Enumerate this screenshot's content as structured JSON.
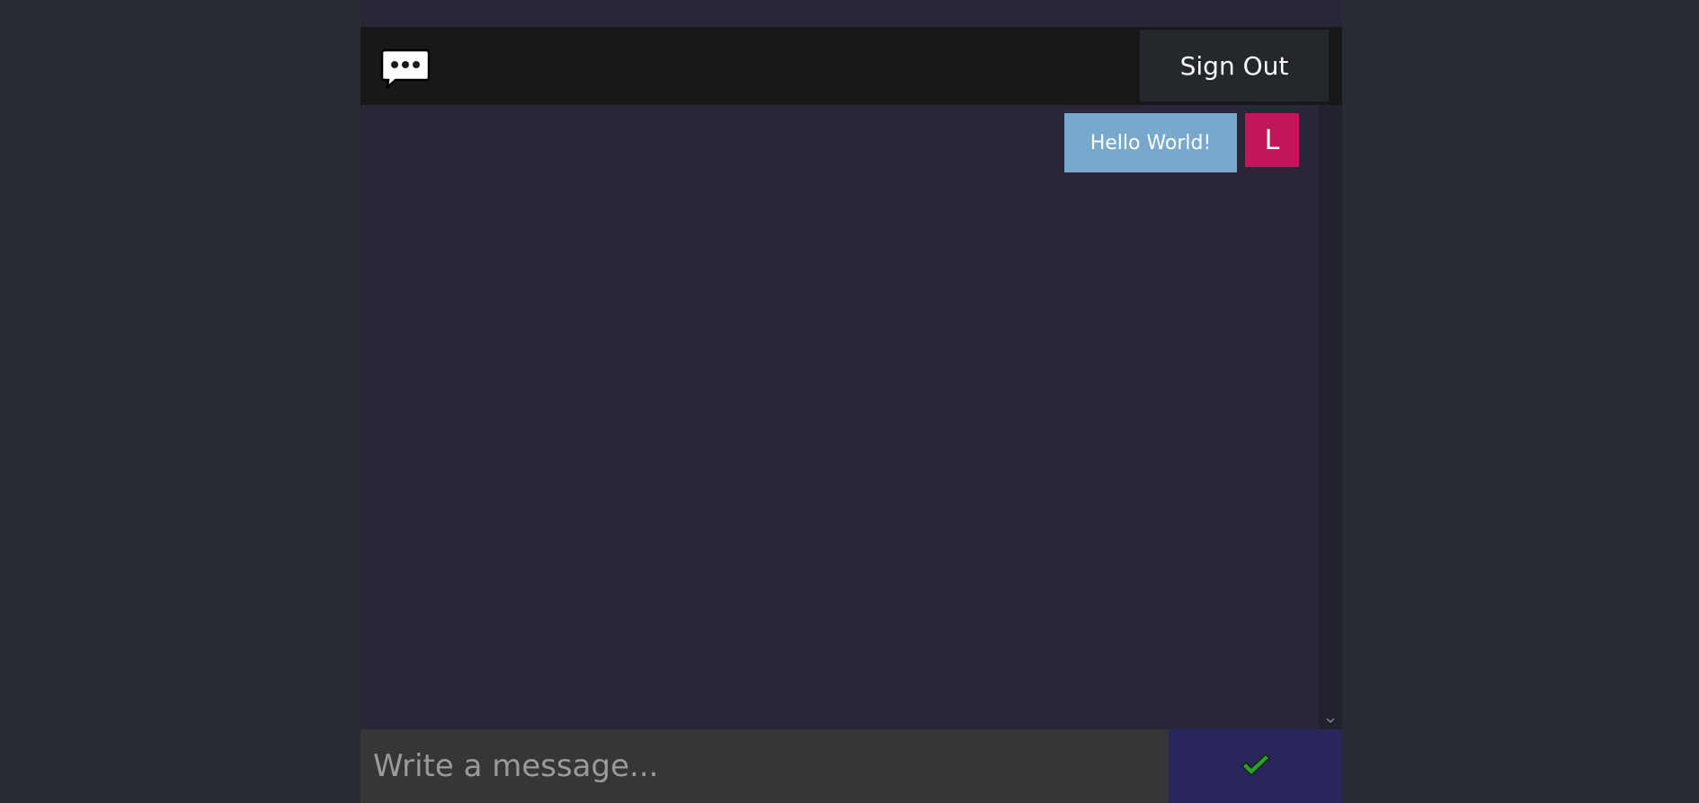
{
  "header": {
    "logo_icon": "chat-bubble-icon",
    "signout_label": "Sign Out"
  },
  "messages": [
    {
      "text": "Hello World!",
      "avatar_initial": "L",
      "avatar_color": "#c2185b"
    }
  ],
  "composer": {
    "placeholder": "Write a message...",
    "send_icon": "checkmark-icon"
  },
  "colors": {
    "page_bg": "#272b32",
    "app_bg": "#282637",
    "header_bg": "#181818",
    "bubble_bg": "#78a9cd",
    "send_bg": "#28265a",
    "check_green": "#2e9e2e"
  }
}
